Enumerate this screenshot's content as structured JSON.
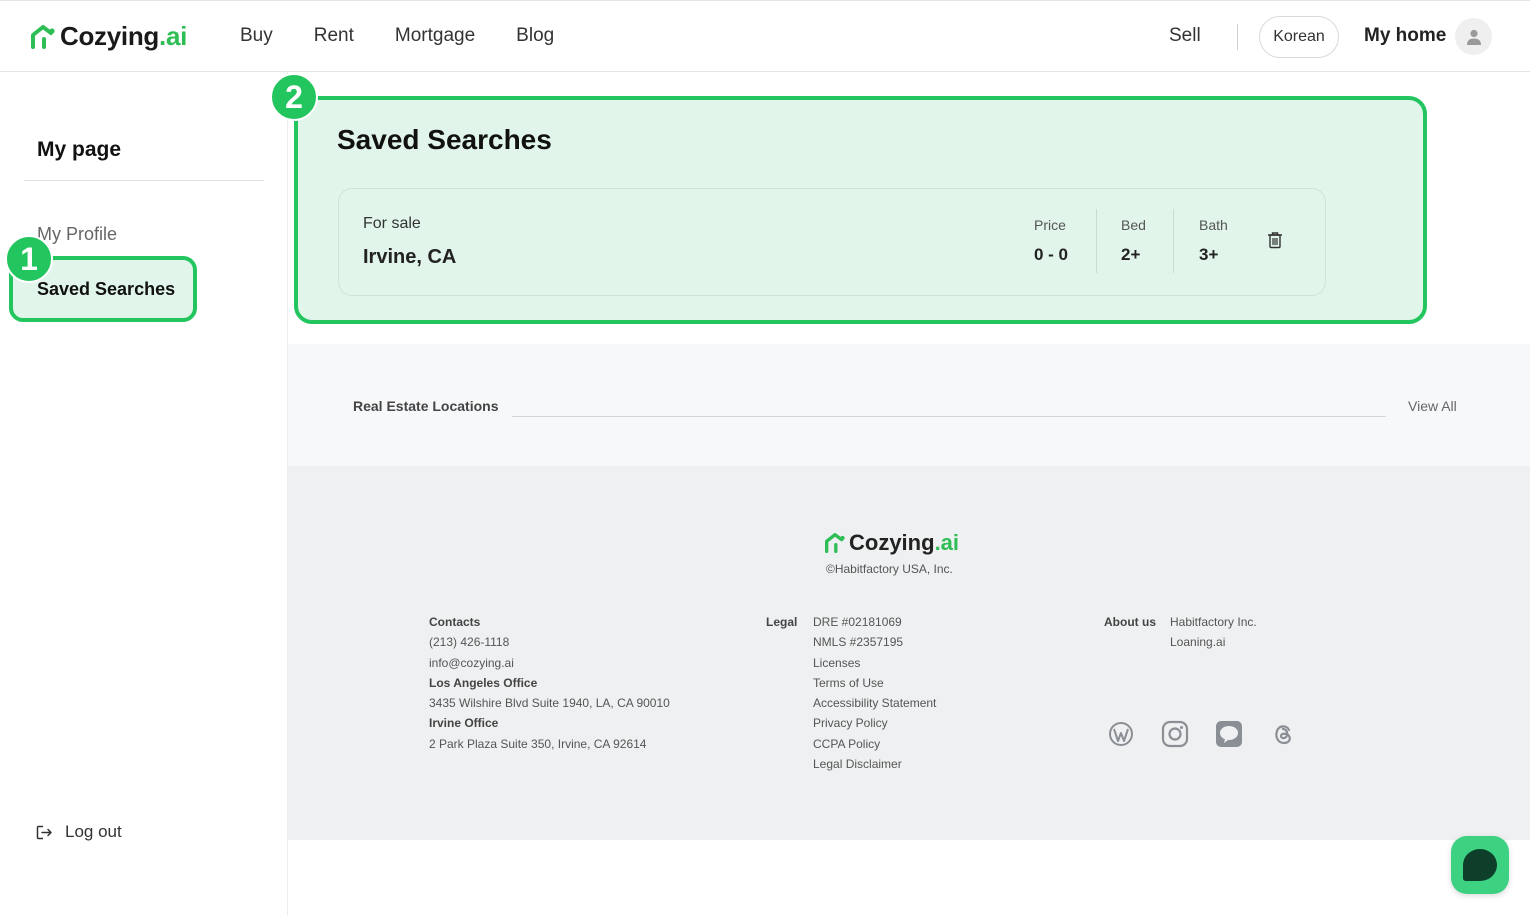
{
  "header": {
    "brand": "Cozying",
    "brand_suffix": ".ai",
    "nav": [
      "Buy",
      "Rent",
      "Mortgage",
      "Blog"
    ],
    "sell": "Sell",
    "language": "Korean",
    "my_home": "My home"
  },
  "sidebar": {
    "title": "My page",
    "items": [
      {
        "label": "My Profile"
      },
      {
        "label": "Saved Searches"
      }
    ],
    "logout": "Log out"
  },
  "annotations": {
    "badge1": "1",
    "badge2": "2"
  },
  "saved_searches": {
    "title": "Saved Searches",
    "items": [
      {
        "type": "For sale",
        "location": "Irvine, CA",
        "price_label": "Price",
        "price_value": "0 - 0",
        "bed_label": "Bed",
        "bed_value": "2+",
        "bath_label": "Bath",
        "bath_value": "3+"
      }
    ]
  },
  "locations": {
    "label": "Real Estate Locations",
    "view_all": "View All"
  },
  "footer": {
    "brand": "Cozying",
    "brand_suffix": ".ai",
    "copyright": "©Habitfactory USA, Inc.",
    "contacts": {
      "heading": "Contacts",
      "phone": "(213) 426-1118",
      "email": "info@cozying.ai",
      "la_heading": "Los Angeles Office",
      "la_address": "3435 Wilshire Blvd Suite 1940, LA, CA 90010",
      "irvine_heading": "Irvine Office",
      "irvine_address": "2 Park Plaza Suite 350, Irvine, CA 92614"
    },
    "legal": {
      "heading": "Legal",
      "links": [
        "DRE #02181069",
        "NMLS #2357195",
        "Licenses",
        "Terms of Use",
        "Accessibility Statement",
        "Privacy Policy",
        "CCPA Policy",
        "Legal Disclaimer"
      ]
    },
    "about": {
      "heading": "About us",
      "links": [
        "Habitfactory Inc.",
        "Loaning.ai"
      ]
    },
    "social_icons": [
      "wordpress-icon",
      "instagram-icon",
      "kakaotalk-icon",
      "threads-icon"
    ]
  },
  "colors": {
    "accent": "#22c55e",
    "highlight_bg": "#e1f5ea",
    "chat_button": "#3cd282"
  }
}
